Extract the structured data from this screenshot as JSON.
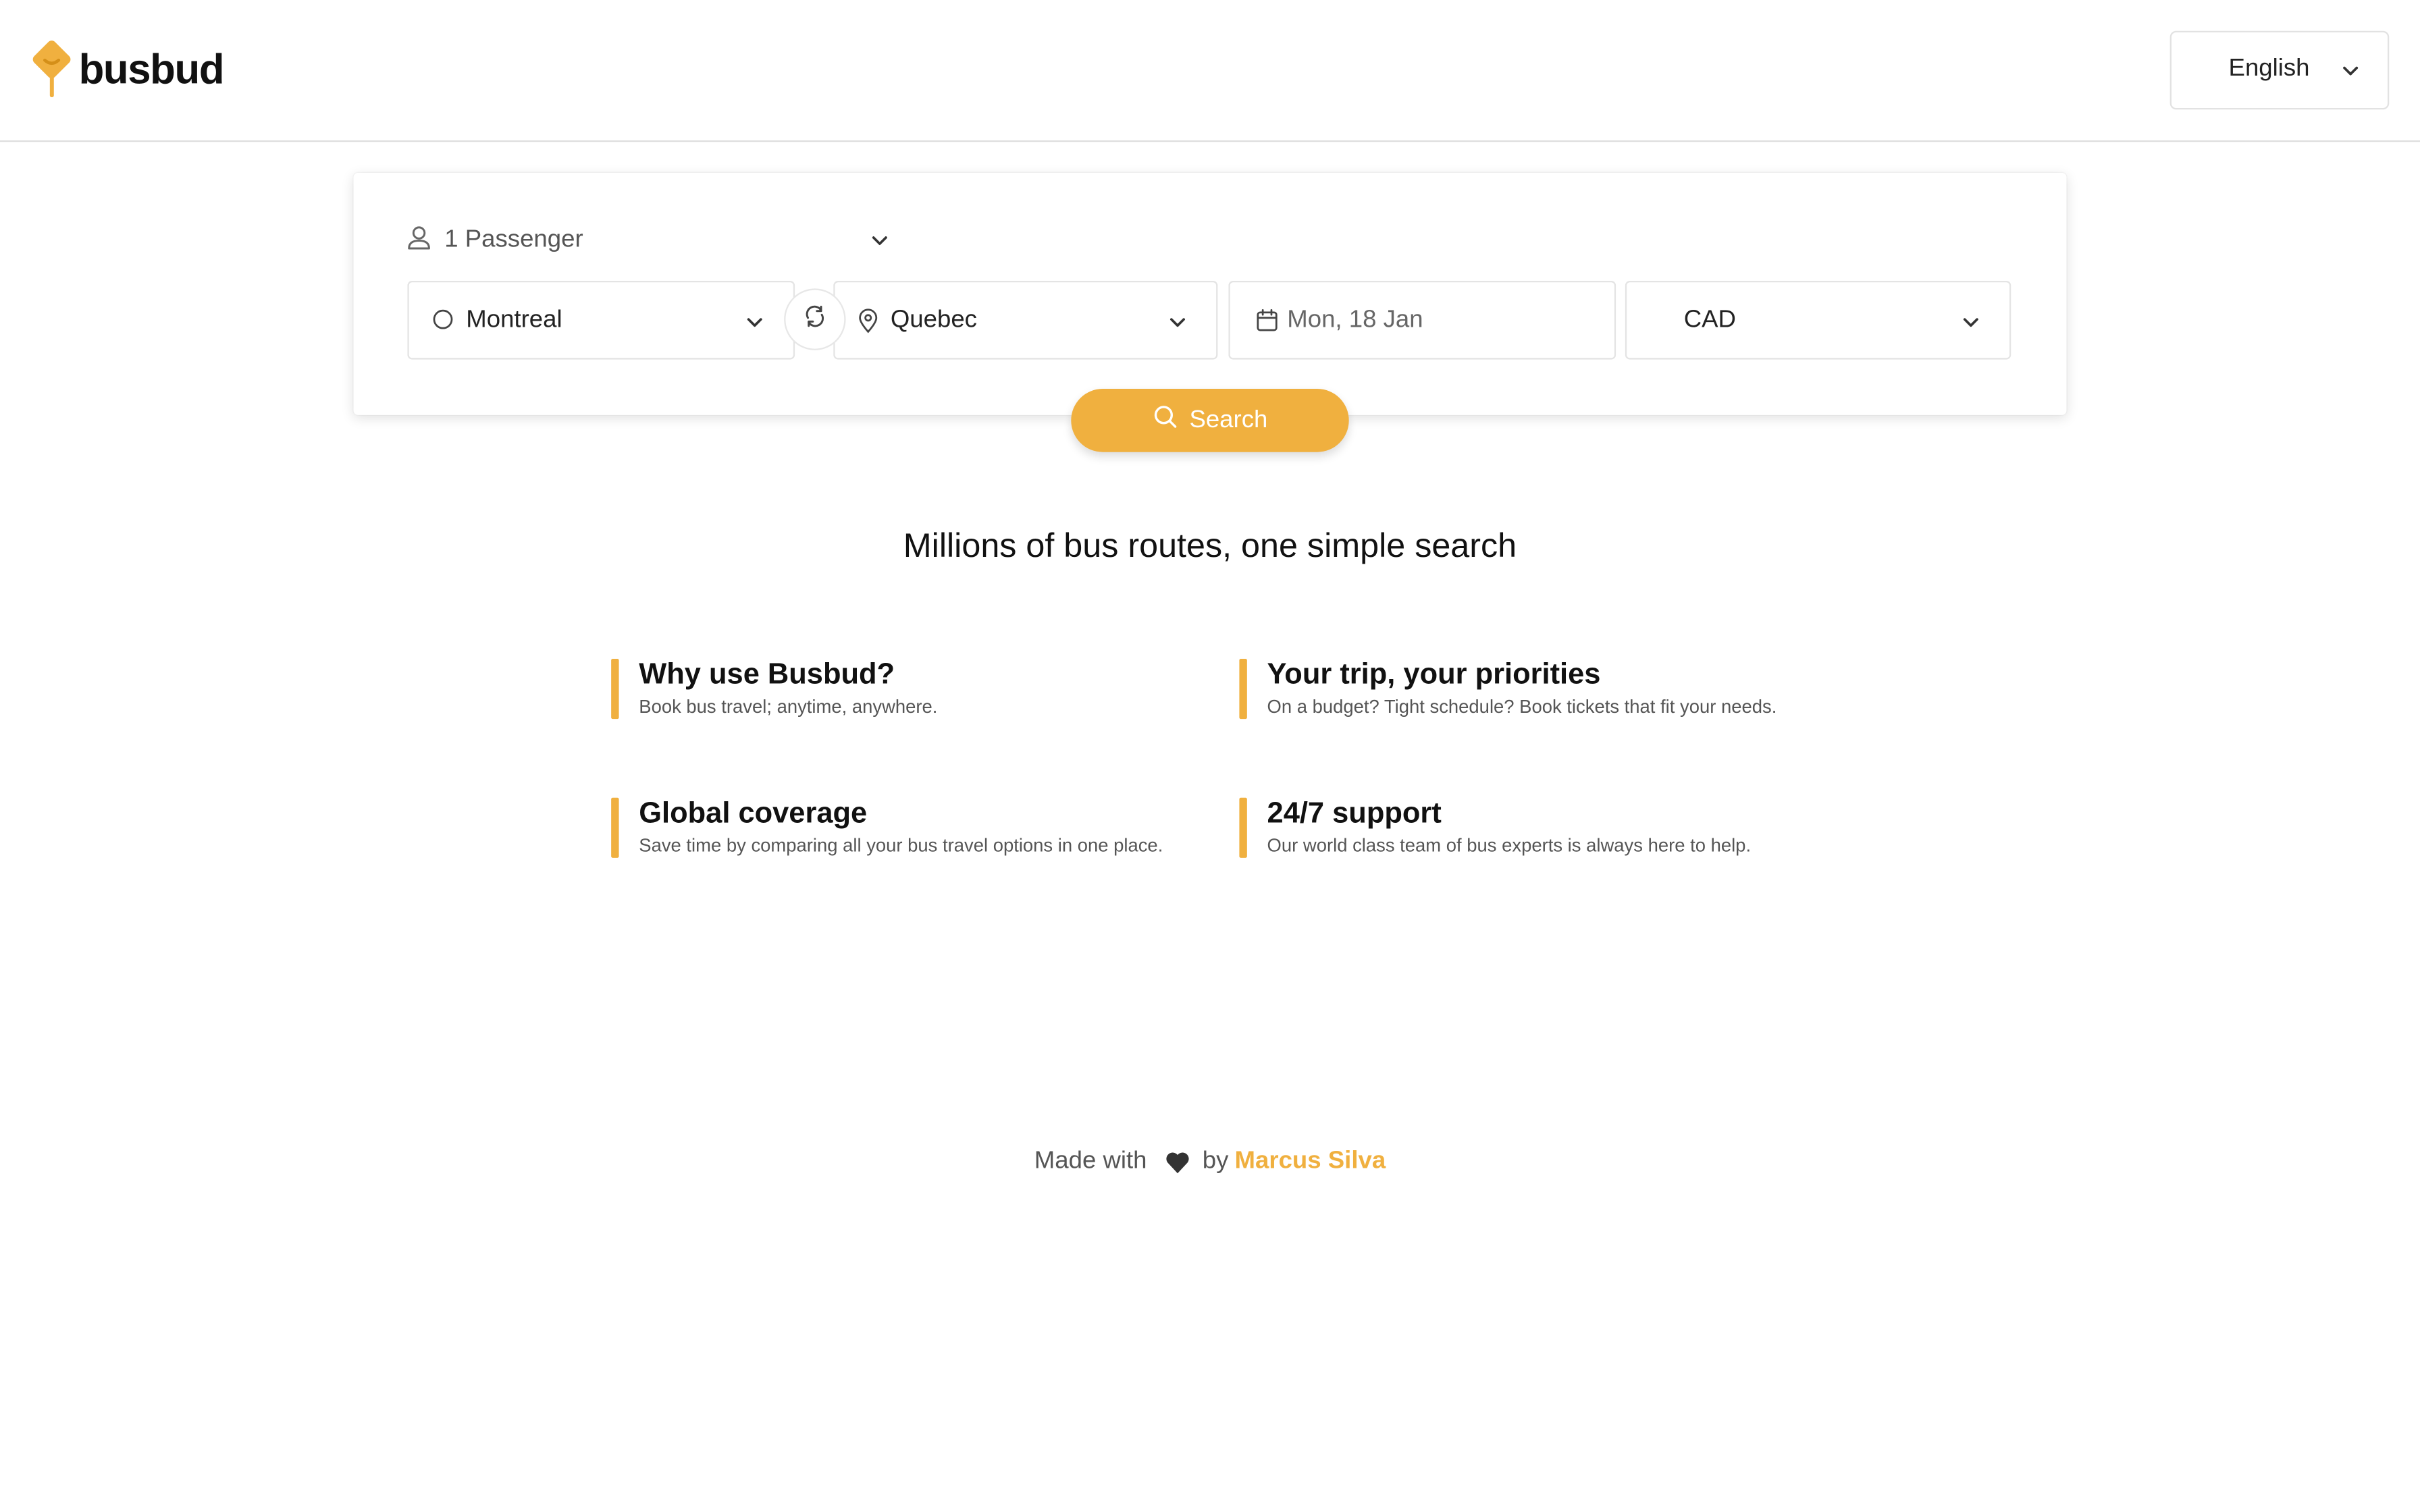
{
  "header": {
    "brand": "busbud",
    "brand_color": "#f0b03f",
    "language": "English"
  },
  "search": {
    "passengers": "1 Passenger",
    "origin": "Montreal",
    "destination": "Quebec",
    "date": "Mon, 18 Jan",
    "currency": "CAD",
    "button_label": "Search",
    "icons": {
      "passengers": "user-icon",
      "origin": "circle-icon",
      "destination": "map-pin-icon",
      "date": "calendar-icon",
      "swap": "swap-icon",
      "search": "search-icon"
    }
  },
  "main": {
    "headline": "Millions of bus routes, one simple search",
    "features": [
      {
        "title": "Why use Busbud?",
        "description": "Book bus travel; anytime, anywhere."
      },
      {
        "title": "Your trip, your priorities",
        "description": "On a budget? Tight schedule? Book tickets that fit your needs."
      },
      {
        "title": "Global coverage",
        "description": "Save time by comparing all your bus travel options in one place."
      },
      {
        "title": "24/7 support",
        "description": "Our world class team of bus experts is always here to help."
      }
    ]
  },
  "footer": {
    "made_with": "Made with",
    "by": "by",
    "author": "Marcus Silva",
    "heart_icon": "heart-icon"
  }
}
